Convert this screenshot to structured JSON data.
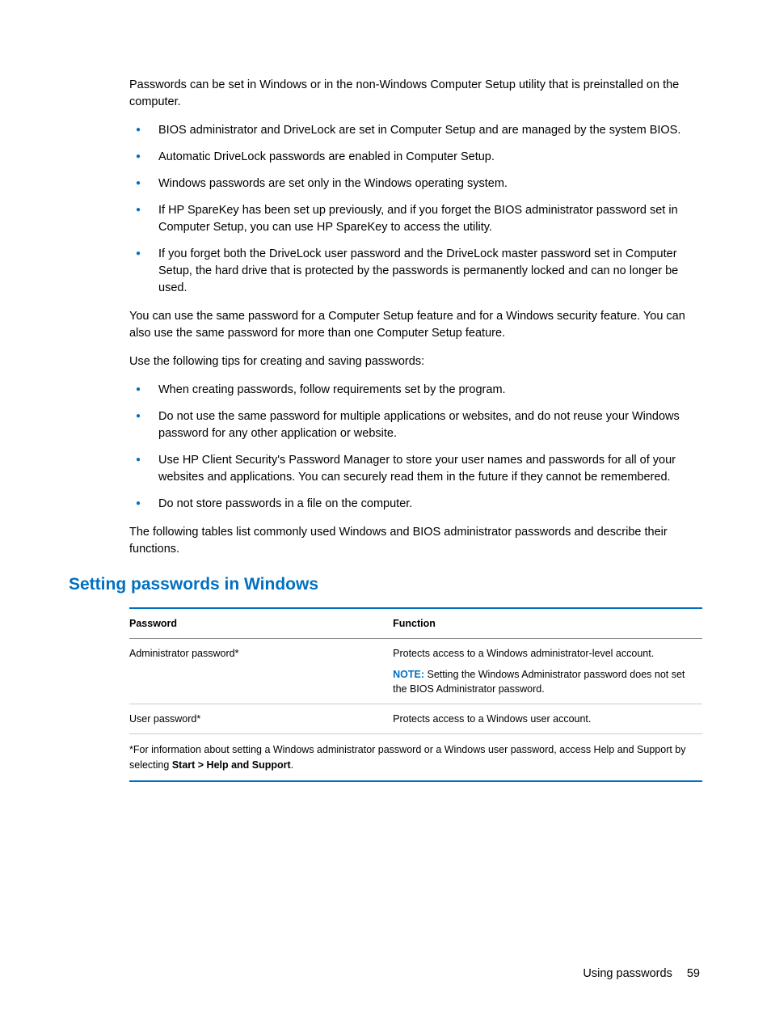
{
  "intro": "Passwords can be set in Windows or in the non-Windows Computer Setup utility that is preinstalled on the computer.",
  "bullets1": [
    "BIOS administrator and DriveLock are set in Computer Setup and are managed by the system BIOS.",
    "Automatic DriveLock passwords are enabled in Computer Setup.",
    "Windows passwords are set only in the Windows operating system.",
    "If HP SpareKey has been set up previously, and if you forget the BIOS administrator password set in Computer Setup, you can use HP SpareKey to access the utility.",
    "If you forget both the DriveLock user password and the DriveLock master password set in Computer Setup, the hard drive that is protected by the passwords is permanently locked and can no longer be used."
  ],
  "para2": "You can use the same password for a Computer Setup feature and for a Windows security feature. You can also use the same password for more than one Computer Setup feature.",
  "para3": "Use the following tips for creating and saving passwords:",
  "bullets2": [
    "When creating passwords, follow requirements set by the program.",
    "Do not use the same password for multiple applications or websites, and do not reuse your Windows password for any other application or website.",
    "Use HP Client Security's Password Manager to store your user names and passwords for all of your websites and applications. You can securely read them in the future if they cannot be remembered.",
    "Do not store passwords in a file on the computer."
  ],
  "para4": "The following tables list commonly used Windows and BIOS administrator passwords and describe their functions.",
  "heading": "Setting passwords in Windows",
  "table": {
    "headers": {
      "password": "Password",
      "function": "Function"
    },
    "rows": [
      {
        "password": "Administrator password*",
        "function": "Protects access to a Windows administrator-level account.",
        "note_label": "NOTE:",
        "note_text": "Setting the Windows Administrator password does not set the BIOS Administrator password."
      },
      {
        "password": "User password*",
        "function": "Protects access to a Windows user account."
      }
    ],
    "footnote_pre": "*For information about setting a Windows administrator password or a Windows user password, access Help and Support by selecting ",
    "footnote_bold": "Start > Help and Support",
    "footnote_post": "."
  },
  "footer": {
    "title": "Using passwords",
    "page": "59"
  }
}
